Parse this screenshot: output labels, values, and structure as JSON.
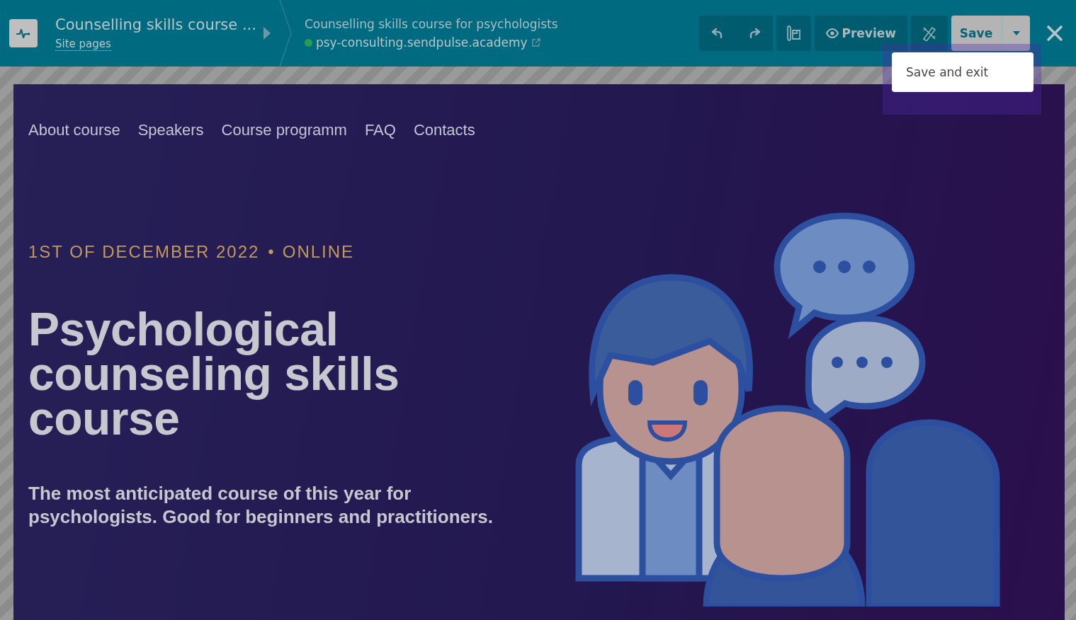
{
  "toolbar": {
    "app_title": "Counselling skills course ...",
    "site_pages_link": "Site pages",
    "site_title": "Counselling skills course for psychologists",
    "site_url": "psy-consulting.sendpulse.academy",
    "preview_button": "Preview",
    "save_button": "Save"
  },
  "save_menu": {
    "expanded": true,
    "items": [
      "Save and exit"
    ]
  },
  "page": {
    "nav": [
      "About course",
      "Speakers",
      "Course programm",
      "FAQ",
      "Contacts"
    ],
    "eyebrow": "1ST OF DECEMBER 2022",
    "eyebrow_separator": "•",
    "eyebrow_mode": "ONLINE",
    "headline": "Psychological counseling skills course",
    "subheadline": "The most anticipated course of this year for psychologists. Good for beginners and practitioners."
  }
}
